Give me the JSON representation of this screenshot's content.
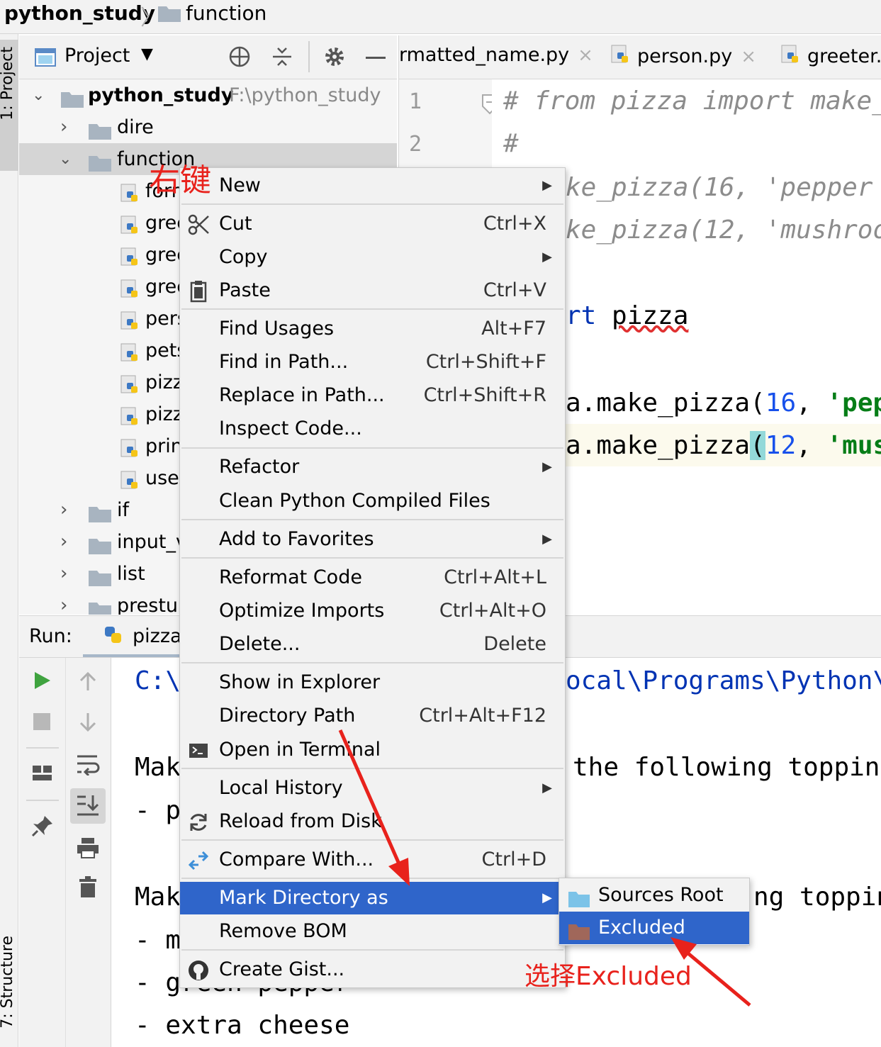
{
  "breadcrumb": {
    "root": "python_study",
    "separator": "〉",
    "child": "function"
  },
  "left_stripe": {
    "project_tab": "1: Project",
    "structure_tab": "7: Structure"
  },
  "project_panel": {
    "title": "Project",
    "tree": [
      {
        "name": "python_study",
        "path": "F:\\python_study",
        "expanded": true,
        "type": "folder"
      },
      {
        "name": "dire",
        "expanded": false,
        "type": "folder"
      },
      {
        "name": "function",
        "expanded": true,
        "type": "folder"
      },
      {
        "name": "forr",
        "type": "pyfile"
      },
      {
        "name": "gree",
        "type": "pyfile"
      },
      {
        "name": "gree",
        "type": "pyfile"
      },
      {
        "name": "gree",
        "type": "pyfile"
      },
      {
        "name": "pers",
        "type": "pyfile"
      },
      {
        "name": "pets",
        "type": "pyfile"
      },
      {
        "name": "pizz",
        "type": "pyfile"
      },
      {
        "name": "pizz",
        "type": "pyfile"
      },
      {
        "name": "prin",
        "type": "pyfile"
      },
      {
        "name": "use",
        "type": "pyfile"
      },
      {
        "name": "if",
        "expanded": false,
        "type": "folder"
      },
      {
        "name": "input_v",
        "expanded": false,
        "type": "folder"
      },
      {
        "name": "list",
        "expanded": false,
        "type": "folder"
      },
      {
        "name": "prestu",
        "expanded": false,
        "type": "folder"
      }
    ]
  },
  "editor": {
    "tabs": [
      {
        "label": "rmatted_name.py",
        "close": "×"
      },
      {
        "label": "person.py",
        "close": "×"
      },
      {
        "label": "greeter.p",
        "close": ""
      }
    ],
    "gutter": [
      "1",
      "2"
    ],
    "lines": {
      "l1": "# from pizza import make_",
      "l2": "#",
      "l3a": "ke_pizza(16, 'pepper",
      "l4a": "ke_pizza(12, 'mushroo",
      "l5a": "rt ",
      "l5b": "pizza",
      "l6a": "a.make_pizza(",
      "l6b": "16",
      "l6c": ", ",
      "l6d": "'pep",
      "l7a": "a.make_pizza",
      "l7p": "(",
      "l7b": "12",
      "l7c": ", ",
      "l7d": "'mus"
    }
  },
  "run_panel": {
    "label": "Run:",
    "tab": "pizza",
    "output": {
      "o1": "C:\\",
      "o1b": "ocal\\Programs\\Python\\",
      "o2": "Mak",
      "o2b": "the following toppin",
      "o3": "- p",
      "o4": "Mak",
      "o4b": "ng toppin",
      "o5": "- m",
      "o6": "- green pepper",
      "o7": "- extra cheese"
    }
  },
  "context_menu": {
    "new": "New",
    "cut": "Cut",
    "cut_sc": "Ctrl+X",
    "copy": "Copy",
    "paste": "Paste",
    "paste_sc": "Ctrl+V",
    "find_usages": "Find Usages",
    "find_usages_sc": "Alt+F7",
    "find_in_path": "Find in Path...",
    "find_in_path_sc": "Ctrl+Shift+F",
    "replace_in_path": "Replace in Path...",
    "replace_in_path_sc": "Ctrl+Shift+R",
    "inspect_code": "Inspect Code...",
    "refactor": "Refactor",
    "clean_python": "Clean Python Compiled Files",
    "add_favorites": "Add to Favorites",
    "reformat": "Reformat Code",
    "reformat_sc": "Ctrl+Alt+L",
    "optimize": "Optimize Imports",
    "optimize_sc": "Ctrl+Alt+O",
    "delete": "Delete...",
    "delete_sc": "Delete",
    "show_explorer": "Show in Explorer",
    "dir_path": "Directory Path",
    "dir_path_sc": "Ctrl+Alt+F12",
    "open_terminal": "Open in Terminal",
    "local_history": "Local History",
    "reload_disk": "Reload from Disk",
    "compare": "Compare With...",
    "compare_sc": "Ctrl+D",
    "mark_dir": "Mark Directory as",
    "remove_bom": "Remove BOM",
    "create_gist": "Create Gist..."
  },
  "submenu": {
    "sources_root": "Sources Root",
    "excluded": "Excluded"
  },
  "annotations": {
    "right_click": "右键",
    "choose_excluded": "选择Excluded"
  },
  "colors": {
    "highlight": "#2f65ca",
    "annotation": "#e8221c",
    "folder": "#a8b4c0",
    "source_folder": "#7cc3e8",
    "excluded_folder": "#a0675a"
  }
}
